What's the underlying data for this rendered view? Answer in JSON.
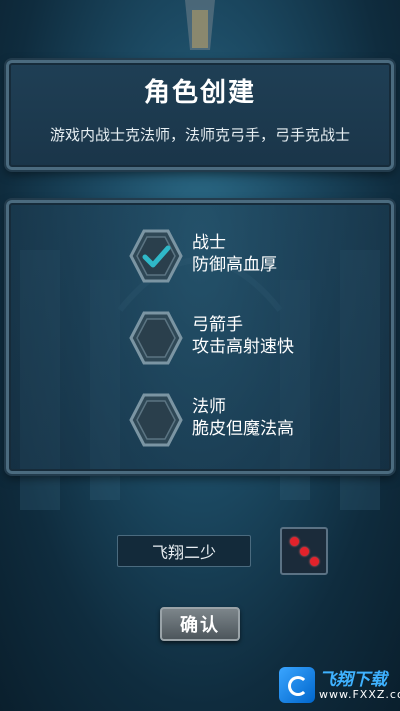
{
  "header": {
    "title": "角色创建",
    "subtitle": "游戏内战士克法师，法师克弓手，弓手克战士"
  },
  "roles": [
    {
      "name": "战士",
      "desc": "防御高血厚",
      "selected": true,
      "icon": "check-icon"
    },
    {
      "name": "弓箭手",
      "desc": "攻击高射速快",
      "selected": false,
      "icon": ""
    },
    {
      "name": "法师",
      "desc": "脆皮但魔法高",
      "selected": false,
      "icon": ""
    }
  ],
  "name_input": {
    "value": "飞翔二少"
  },
  "dice": {
    "icon": "dice-icon",
    "pips": 3,
    "pip_color": "#e2222b"
  },
  "confirm": {
    "label": "确认"
  },
  "watermark": {
    "text": "飞翔下载",
    "url": "www.FXXZ.com"
  },
  "colors": {
    "accent": "#2fb8c8",
    "panel": "#1f3f55",
    "border": "#4b6b7f"
  }
}
